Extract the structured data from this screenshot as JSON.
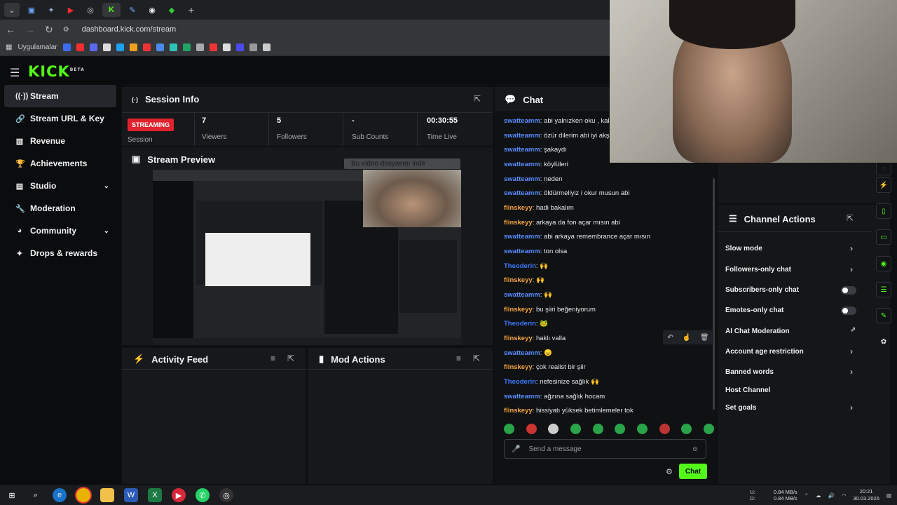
{
  "browser": {
    "url": "dashboard.kick.com/stream",
    "bookmarks_label": "Uygulamalar"
  },
  "brand": {
    "logo": "KICK",
    "beta": "BETA",
    "accent": "#53fc18"
  },
  "sidebar": {
    "items": [
      {
        "label": "Stream",
        "icon": "broadcast-icon"
      },
      {
        "label": "Stream URL & Key",
        "icon": "link-icon"
      },
      {
        "label": "Revenue",
        "icon": "chart-icon"
      },
      {
        "label": "Achievements",
        "icon": "trophy-icon"
      },
      {
        "label": "Studio",
        "icon": "studio-icon"
      },
      {
        "label": "Moderation",
        "icon": "wrench-icon"
      },
      {
        "label": "Community",
        "icon": "community-icon"
      },
      {
        "label": "Drops & rewards",
        "icon": "gift-icon"
      }
    ]
  },
  "session": {
    "title": "Session Info",
    "badge": "STREAMING",
    "session_label": "Session",
    "stats": [
      {
        "value": "7",
        "label": "Viewers"
      },
      {
        "value": "5",
        "label": "Followers"
      },
      {
        "value": "-",
        "label": "Sub Counts"
      },
      {
        "value": "00:30:55",
        "label": "Time Live"
      }
    ]
  },
  "preview": {
    "title": "Stream Preview",
    "download_bar": "Bu video dosyasını indir"
  },
  "activity": {
    "title": "Activity Feed"
  },
  "mod_actions": {
    "title": "Mod Actions"
  },
  "chat": {
    "title": "Chat",
    "placeholder": "Send a message",
    "send_label": "Chat",
    "messages": [
      {
        "user": "swatteamm",
        "color": "#5b8cff",
        "text": "abi yalnızken oku , kala"
      },
      {
        "user": "swatteamm",
        "color": "#5b8cff",
        "text": "özür dilerim abi iyi akşa"
      },
      {
        "user": "swatteamm",
        "color": "#5b8cff",
        "text": "şakaydı"
      },
      {
        "user": "swatteamm",
        "color": "#5b8cff",
        "text": "köylüleri"
      },
      {
        "user": "swatteamm",
        "color": "#5b8cff",
        "text": "neden"
      },
      {
        "user": "swatteamm",
        "color": "#5b8cff",
        "text": "öldürmeliyiz i okur musun abi"
      },
      {
        "user": "flinskeyy",
        "color": "#f4a340",
        "text": "hadi bakalım"
      },
      {
        "user": "flinskeyy",
        "color": "#f4a340",
        "text": "arkaya da fon açar mısın abi"
      },
      {
        "user": "swatteamm",
        "color": "#5b8cff",
        "text": "abi arkaya remembrance açar mısın"
      },
      {
        "user": "swatteamm",
        "color": "#5b8cff",
        "text": "ton olsa"
      },
      {
        "user": "Theoderin",
        "color": "#3d7bff",
        "text": "🙌"
      },
      {
        "user": "flinskeyy",
        "color": "#f4a340",
        "text": "🙌"
      },
      {
        "user": "swatteamm",
        "color": "#5b8cff",
        "text": "🙌"
      },
      {
        "user": "flinskeyy",
        "color": "#f4a340",
        "text": "bu şiiri beğeniyorum"
      },
      {
        "user": "Theoderin",
        "color": "#3d7bff",
        "text": "🐸"
      },
      {
        "user": "flinskeyy",
        "color": "#f4a340",
        "text": "haklı valla"
      },
      {
        "user": "swatteamm",
        "color": "#5b8cff",
        "text": "😠"
      },
      {
        "user": "flinskeyy",
        "color": "#f4a340",
        "text": "çok realist bir şiir"
      },
      {
        "user": "Theoderin",
        "color": "#3d7bff",
        "text": "nefesinize sağlık 🙌"
      },
      {
        "user": "swatteamm",
        "color": "#5b8cff",
        "text": "ağzına sağlık hocam"
      },
      {
        "user": "flinskeyy",
        "color": "#f4a340",
        "text": "hissiyatı yüksek betimlemeler tok"
      }
    ]
  },
  "channel_actions": {
    "title": "Channel Actions",
    "items": [
      {
        "label": "Slow mode",
        "control": "chevron"
      },
      {
        "label": "Followers-only chat",
        "control": "chevron"
      },
      {
        "label": "Subscribers-only chat",
        "control": "toggle"
      },
      {
        "label": "Emotes-only chat",
        "control": "toggle"
      },
      {
        "label": "AI Chat Moderation",
        "control": "external"
      },
      {
        "label": "Account age restriction",
        "control": "chevron"
      },
      {
        "label": "Banned words",
        "control": "chevron"
      },
      {
        "label": "Host Channel",
        "control": "none"
      },
      {
        "label": "Set goals",
        "control": "chevron"
      }
    ]
  },
  "tray": {
    "net_up": "0.84 MB/s",
    "net_down": "0.84 MB/s",
    "up_label": "U:",
    "down_label": "D:",
    "time": "20:21",
    "date": "30.03.2026"
  }
}
